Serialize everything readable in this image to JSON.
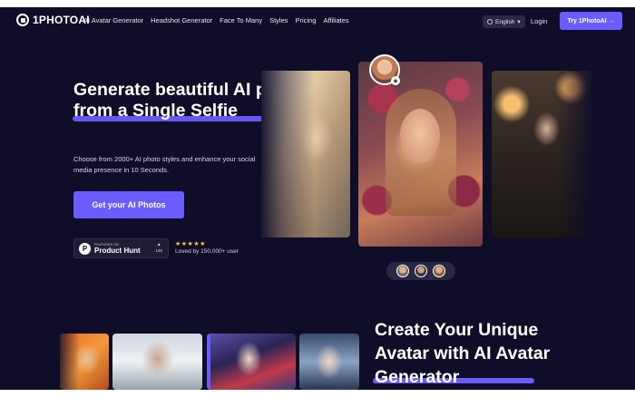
{
  "brand": {
    "logo_text": "1PHOTOAI"
  },
  "nav": {
    "links": [
      "AI Avatar Generator",
      "Headshot Generator",
      "Face To Many",
      "Styles",
      "Pricing",
      "Affiliates"
    ],
    "language": "English",
    "login": "Login",
    "cta": "Try 1PhotoAI →"
  },
  "hero": {
    "headline_line1": "Generate beautiful AI photos",
    "headline_line2": "from a Single Selfie",
    "subtext": "Choose from 2000+ AI photo styles and enhance your social media presence in 10 Seconds.",
    "cta": "Get your AI Photos",
    "product_hunt": {
      "small": "FEATURED ON",
      "big": "Product Hunt",
      "votes": "145"
    },
    "rating": {
      "stars": "★★★★★",
      "text": "Loved by 150,000+ user"
    }
  },
  "section2": {
    "headline_line1": "Create Your Unique",
    "headline_line2": "Avatar with AI Avatar",
    "headline_line3": "Generator"
  },
  "colors": {
    "background": "#0f0d28",
    "accent": "#6b5cff",
    "star": "#f7c43a"
  }
}
